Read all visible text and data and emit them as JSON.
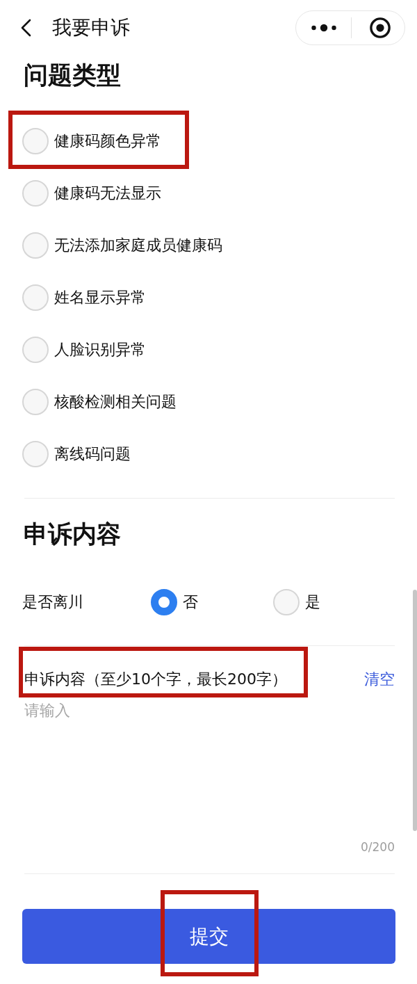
{
  "nav": {
    "title": "我要申诉"
  },
  "problem_type": {
    "heading": "问题类型",
    "options": [
      {
        "label": "健康码颜色异常",
        "selected": false,
        "highlighted": true
      },
      {
        "label": "健康码无法显示",
        "selected": false,
        "highlighted": false
      },
      {
        "label": "无法添加家庭成员健康码",
        "selected": false,
        "highlighted": false
      },
      {
        "label": "姓名显示异常",
        "selected": false,
        "highlighted": false
      },
      {
        "label": "人脸识别异常",
        "selected": false,
        "highlighted": false
      },
      {
        "label": "核酸检测相关问题",
        "selected": false,
        "highlighted": false
      },
      {
        "label": "离线码问题",
        "selected": false,
        "highlighted": false
      }
    ]
  },
  "appeal": {
    "heading": "申诉内容",
    "left_sichuan": {
      "label": "是否离川",
      "options": [
        {
          "label": "否",
          "selected": true
        },
        {
          "label": "是",
          "selected": false
        }
      ]
    },
    "content": {
      "label": "申诉内容（至少10个字，最长200字）",
      "highlighted": true,
      "clear": "清空",
      "placeholder": "请输入",
      "counter": "0/200"
    }
  },
  "submit": {
    "label": "提交",
    "highlighted": true
  }
}
